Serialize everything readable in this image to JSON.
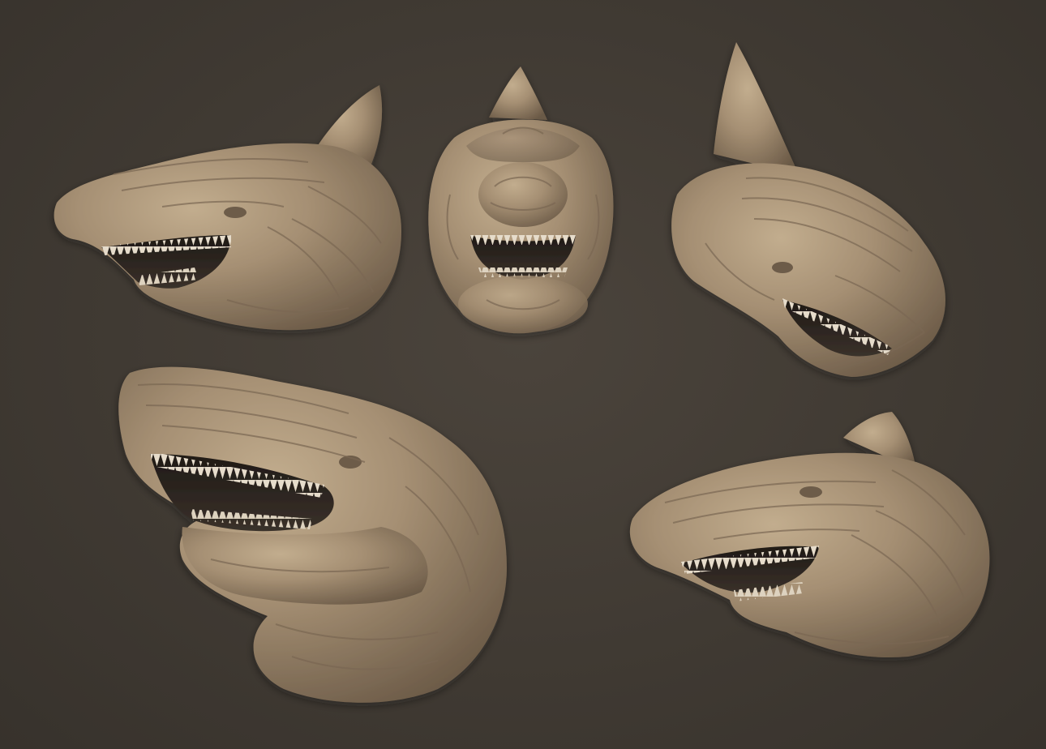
{
  "scene": {
    "background_color": "#433d36",
    "clay_color": "#a58f73",
    "clay_shadow_color": "#5a4c3c",
    "teeth_color": "#e6dccb",
    "mouth_color": "#2a2420",
    "views": [
      {
        "name": "side-view-left",
        "icon": "creature-head-side"
      },
      {
        "name": "front-view",
        "icon": "creature-head-front"
      },
      {
        "name": "three-quarter-view-right",
        "icon": "creature-head-three-quarter"
      },
      {
        "name": "three-quarter-view-open-mouth",
        "icon": "creature-head-low-angle"
      },
      {
        "name": "side-view-right-tilted",
        "icon": "creature-head-side-tilted"
      }
    ]
  }
}
